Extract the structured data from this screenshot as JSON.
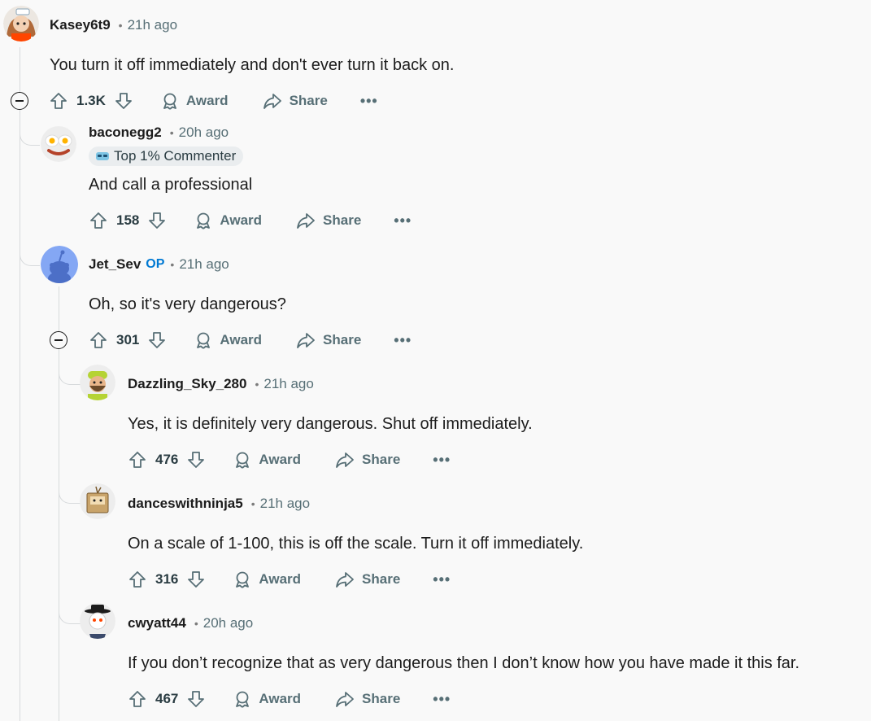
{
  "comments": [
    {
      "author": "Kasey6t9",
      "time": "21h ago",
      "body": "You turn it off immediately and don't ever turn it back on.",
      "votes": "1.3K",
      "award": "Award",
      "share": "Share",
      "more": "•••"
    },
    {
      "author": "baconegg2",
      "time": "20h ago",
      "flair": "Top 1% Commenter",
      "body": "And call a professional",
      "votes": "158",
      "award": "Award",
      "share": "Share",
      "more": "•••"
    },
    {
      "author": "Jet_Sev",
      "op": "OP",
      "time": "21h ago",
      "body": "Oh, so it's very dangerous?",
      "votes": "301",
      "award": "Award",
      "share": "Share",
      "more": "•••"
    },
    {
      "author": "Dazzling_Sky_280",
      "time": "21h ago",
      "body": "Yes, it is definitely very dangerous. Shut off immediately.",
      "votes": "476",
      "award": "Award",
      "share": "Share",
      "more": "•••"
    },
    {
      "author": "danceswithninja5",
      "time": "21h ago",
      "body": "On a scale of 1-100, this is off the scale. Turn it off immediately.",
      "votes": "316",
      "award": "Award",
      "share": "Share",
      "more": "•••"
    },
    {
      "author": "cwyatt44",
      "time": "20h ago",
      "body": "If you don’t recognize that as very dangerous then I don’t know how you have made it this far.",
      "votes": "467",
      "award": "Award",
      "share": "Share",
      "more": "•••"
    }
  ],
  "separator": "•",
  "colors": {
    "background": "#f9f9f9",
    "text": "#1c1c1c",
    "meta": "#576f76",
    "op": "#0079d3",
    "thread": "#d7dadc"
  }
}
